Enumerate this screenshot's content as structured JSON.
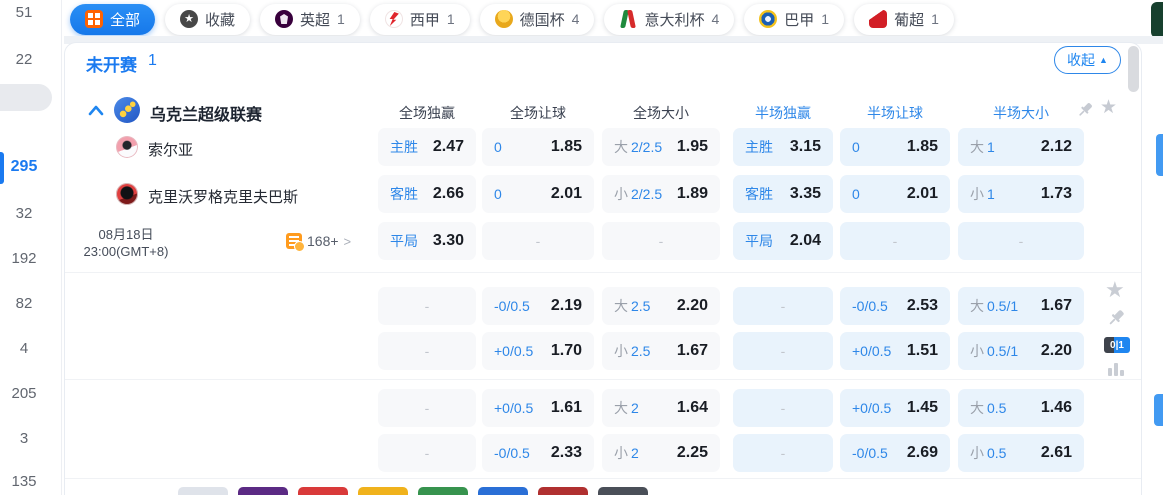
{
  "colors": {
    "accent_blue": "#1f86f0",
    "halftime_cell_bg": "#e9f3fc",
    "fulltime_cell_bg": "#f7f8fa",
    "bottom_chip_colors": [
      "#dfe3ea",
      "#5b2a84",
      "#d93a3a",
      "#f0b21c",
      "#37934e",
      "#2a6fd6",
      "#b03030",
      "#4a4f58"
    ]
  },
  "sidebar": {
    "counts": [
      "51",
      "22",
      "295",
      "32",
      "192",
      "82",
      "4",
      "205",
      "3",
      "135"
    ],
    "active_index": 2
  },
  "tabbar": {
    "tabs": [
      {
        "label": "全部",
        "count": "",
        "icon": "grid-icon",
        "active": true
      },
      {
        "label": "收藏",
        "count": "",
        "icon": "favorites-star-icon",
        "active": false
      },
      {
        "label": "英超",
        "count": "1",
        "icon": "premier-league-icon",
        "active": false
      },
      {
        "label": "西甲",
        "count": "1",
        "icon": "laliga-icon",
        "active": false
      },
      {
        "label": "德国杯",
        "count": "4",
        "icon": "german-cup-icon",
        "active": false
      },
      {
        "label": "意大利杯",
        "count": "4",
        "icon": "italy-cup-icon",
        "active": false
      },
      {
        "label": "巴甲",
        "count": "1",
        "icon": "brazil-serie-a-icon",
        "active": false
      },
      {
        "label": "葡超",
        "count": "1",
        "icon": "portugal-liga-icon",
        "active": false
      }
    ]
  },
  "section": {
    "status_label": "未开赛",
    "status_count": "1",
    "collapse_label": "收起",
    "collapse_arrow": "▲"
  },
  "league": {
    "name": "乌克兰超级联赛",
    "columns": [
      "全场独赢",
      "全场让球",
      "全场大小",
      "半场独赢",
      "半场让球",
      "半场大小"
    ],
    "home_team": "索尔亚",
    "away_team": "克里沃罗格克里夫巴斯",
    "match_date": "08月18日",
    "match_time": "23:00(GMT+8)",
    "more_markets": "168+",
    "more_markets_chevron": ">"
  },
  "odds": {
    "rows": [
      {
        "cells": [
          {
            "lbl": "主胜",
            "val": "2.47"
          },
          {
            "lbl": "0",
            "val": "1.85"
          },
          {
            "pre": "大",
            "lbl": "2/2.5",
            "val": "1.95"
          },
          {
            "lbl": "主胜",
            "val": "3.15"
          },
          {
            "lbl": "0",
            "val": "1.85"
          },
          {
            "pre": "大",
            "lbl": "1",
            "val": "2.12"
          }
        ]
      },
      {
        "cells": [
          {
            "lbl": "客胜",
            "val": "2.66"
          },
          {
            "lbl": "0",
            "val": "2.01"
          },
          {
            "pre": "小",
            "lbl": "2/2.5",
            "val": "1.89"
          },
          {
            "lbl": "客胜",
            "val": "3.35"
          },
          {
            "lbl": "0",
            "val": "2.01"
          },
          {
            "pre": "小",
            "lbl": "1",
            "val": "1.73"
          }
        ]
      },
      {
        "cells": [
          {
            "lbl": "平局",
            "val": "3.30"
          },
          {
            "dash": true
          },
          {
            "dash": true
          },
          {
            "lbl": "平局",
            "val": "2.04"
          },
          {
            "dash": true
          },
          {
            "dash": true
          }
        ]
      },
      {
        "cells": [
          {
            "dash": true
          },
          {
            "lbl": "-0/0.5",
            "val": "2.19"
          },
          {
            "pre": "大",
            "lbl": "2.5",
            "val": "2.20"
          },
          {
            "dash": true
          },
          {
            "lbl": "-0/0.5",
            "val": "2.53"
          },
          {
            "pre": "大",
            "lbl": "0.5/1",
            "val": "1.67"
          }
        ]
      },
      {
        "cells": [
          {
            "dash": true
          },
          {
            "lbl": "+0/0.5",
            "val": "1.70"
          },
          {
            "pre": "小",
            "lbl": "2.5",
            "val": "1.67"
          },
          {
            "dash": true
          },
          {
            "lbl": "+0/0.5",
            "val": "1.51"
          },
          {
            "pre": "小",
            "lbl": "0.5/1",
            "val": "2.20"
          }
        ]
      },
      {
        "cells": [
          {
            "dash": true
          },
          {
            "lbl": "+0/0.5",
            "val": "1.61"
          },
          {
            "pre": "大",
            "lbl": "2",
            "val": "1.64"
          },
          {
            "dash": true
          },
          {
            "lbl": "+0/0.5",
            "val": "1.45"
          },
          {
            "pre": "大",
            "lbl": "0.5",
            "val": "1.46"
          }
        ]
      },
      {
        "cells": [
          {
            "dash": true
          },
          {
            "lbl": "-0/0.5",
            "val": "2.33"
          },
          {
            "pre": "小",
            "lbl": "2",
            "val": "2.25"
          },
          {
            "dash": true
          },
          {
            "lbl": "-0/0.5",
            "val": "2.69"
          },
          {
            "pre": "小",
            "lbl": "0.5",
            "val": "2.61"
          }
        ]
      }
    ]
  },
  "right_toolbar": {
    "odds_format_badge": "0|1"
  }
}
